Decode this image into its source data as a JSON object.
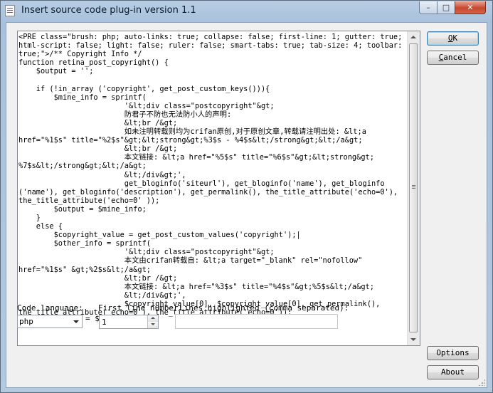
{
  "window": {
    "title": "Insert source code plug-in version 1.1",
    "minimize_glyph": "–",
    "maximize_glyph": "□",
    "close_glyph": "✕"
  },
  "editor": {
    "code": "<PRE class=\"brush: php; auto-links: true; collapse: false; first-line: 1; gutter: true;\nhtml-script: false; light: false; ruler: false; smart-tabs: true; tab-size: 4; toolbar:\ntrue;\">/** Copyright Info */\nfunction retina_post_copyright() {\n    $output = '';\n\n    if (!in_array ('copyright', get_post_custom_keys())){\n        $mine_info = sprintf(\n                        '&lt;div class=\"postcopyright\"&gt;\n                        防君子不防也无法防小人的声明:\n                        &lt;br /&gt;\n                        如未注明转载则均为crifan原创,对于原创文章,转载请注明出处: &lt;a\nhref=\"%1$s\" title=\"%2$s\"&gt;&lt;strong&gt;%3$s - %4$s&lt;/strong&gt;&lt;/a&gt;\n                        &lt;br /&gt;\n                        本文链接: &lt;a href=\"%5$s\" title=\"%6$s\"&gt;&lt;strong&gt;\n%7$s&lt;/strong&gt;&lt;/a&gt;\n                        &lt;/div&gt;',\n                        get_bloginfo('siteurl'), get_bloginfo('name'), get_bloginfo\n('name'), get_bloginfo('description'), get_permalink(), the_title_attribute('echo=0'),\nthe_title_attribute('echo=0' ));\n        $output = $mine_info;\n    }\n    else {\n        $copyright_value = get_post_custom_values('copyright');|\n        $other_info = sprintf(\n                        '&lt;div class=\"postcopyright\"&gt;\n                        本文由crifan转载自: &lt;a target=\"_blank\" rel=\"nofollow\"\nhref=\"%1$s\" &gt;%2$s&lt;/a&gt;\n                        &lt;br /&gt;\n                        本文链接: &lt;a href=\"%3$s\" title=\"%4$s\"&gt;%5$s&lt;/a&gt;\n                        &lt;/div&gt;',\n                        $copyright_value[0], $copyright_value[0], get_permalink(),\nthe_title_attribute('echo=0'), the_title_attribute('echo=0'));"
  },
  "form": {
    "code_language_label": "Code language:",
    "code_language_value": "php",
    "first_line_label": "First line number:",
    "first_line_value": "1",
    "equals_prefix": "= $",
    "lines_highlighted_label": "Lines highlighted (comma separated):",
    "lines_highlighted_value": ""
  },
  "buttons": {
    "ok_mnemonic": "O",
    "ok_rest": "K",
    "cancel_mnemonic": "C",
    "cancel_rest": "ancel",
    "options_label": "Options",
    "about_label": "About"
  }
}
